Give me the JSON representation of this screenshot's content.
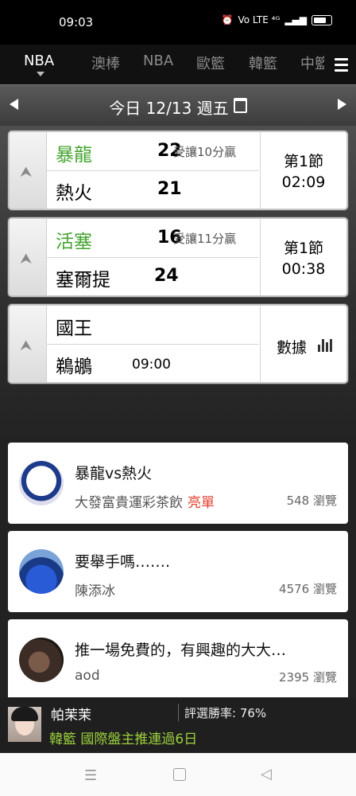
{
  "status_bar": {
    "time": "09:03",
    "signal_text": "Vo LTE ⁴ᴳ"
  },
  "tabs": [
    {
      "label": "NBA",
      "active": true
    },
    {
      "label": "澳棒",
      "active": false
    },
    {
      "label": "NBA",
      "active": false
    },
    {
      "label": "歐籃",
      "active": false
    },
    {
      "label": "韓籃",
      "active": false
    },
    {
      "label": "中籃",
      "active": false
    }
  ],
  "date_bar": {
    "label": "今日 12/13 週五"
  },
  "games": [
    {
      "home": "暴龍",
      "home_color": "#44a52f",
      "home_score": "22",
      "spread": "受讓10分贏",
      "away": "熱火",
      "away_score": "21",
      "away_time": "",
      "status_line1": "第1節",
      "status_line2": "02:09"
    },
    {
      "home": "活塞",
      "home_color": "#44a52f",
      "home_score": "16",
      "spread": "受讓11分贏",
      "away": "塞爾提",
      "away_score": "24",
      "away_time": "",
      "status_line1": "第1節",
      "status_line2": "00:38"
    },
    {
      "home": "國王",
      "home_color": "#000000",
      "home_score": "",
      "spread": "",
      "away": "鵜鶘",
      "away_score": "",
      "away_time": "09:00",
      "stats_label": "數據"
    }
  ],
  "posts": [
    {
      "title": "暴龍vs熱火",
      "author": "大發富貴運彩茶飲",
      "badge": "亮單",
      "views": "548 瀏覽"
    },
    {
      "title": "要舉手嗎…….",
      "author": "陳添冰",
      "badge": "",
      "views": "4576 瀏覽"
    },
    {
      "title": "推一場免費的，有興趣的大大…",
      "author": "aod",
      "badge": "",
      "views": "2395 瀏覽"
    }
  ],
  "promo": {
    "name": "帕茉茉",
    "rate": "評選勝率: 76%",
    "tag": "韓籃 國際盤主推連過6日"
  }
}
